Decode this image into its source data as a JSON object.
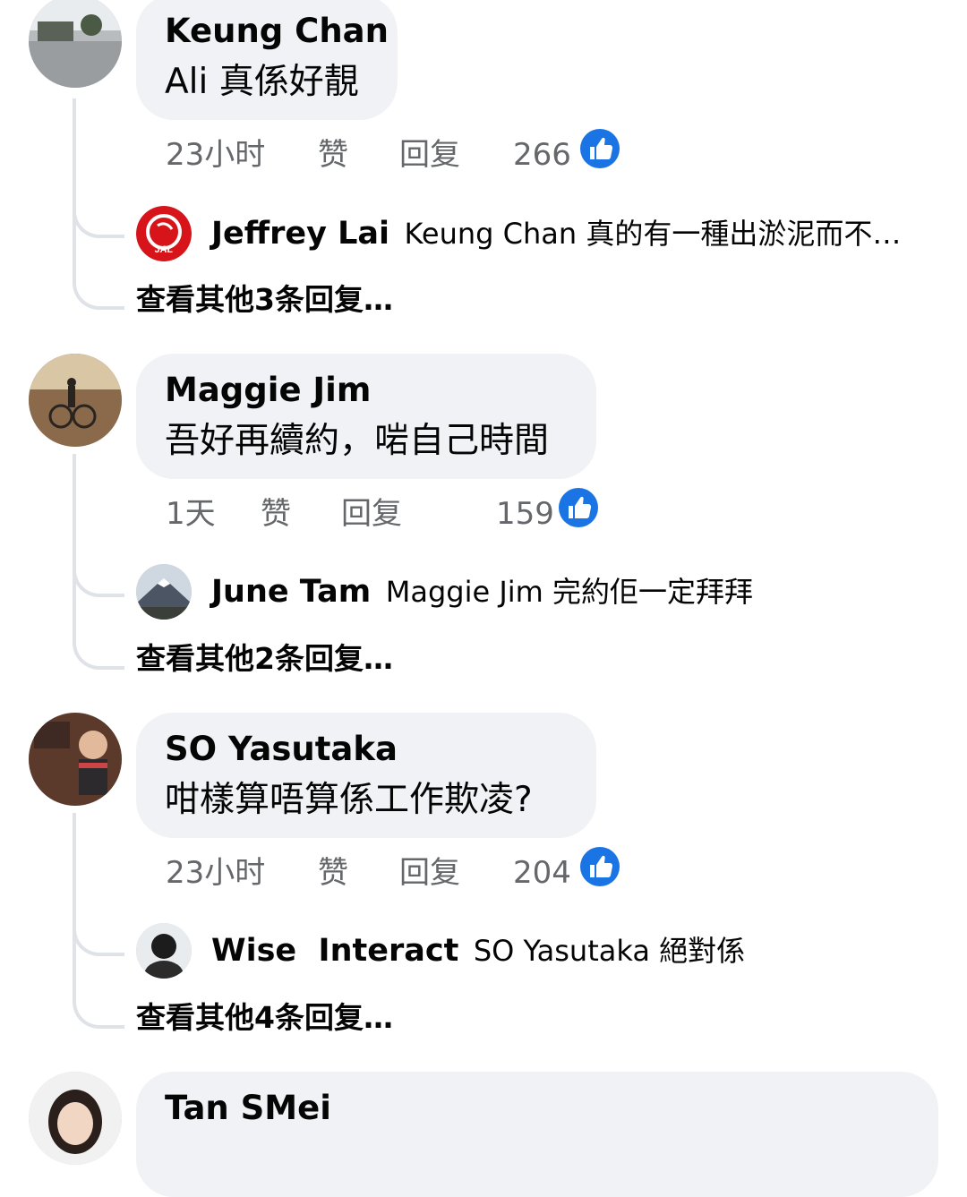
{
  "comments": [
    {
      "author": "Keung Chan",
      "text": "Ali 真係好靚",
      "time": "23小时",
      "like_label": "赞",
      "reply_label": "回复",
      "reactions": "266",
      "reply": {
        "author": "Jeffrey Lai",
        "text": "Keung Chan 真的有一種出淤泥而不…"
      },
      "more_replies": "查看其他3条回复…"
    },
    {
      "author": "Maggie Jim",
      "text": "吾好再續約，啱自己時間",
      "time": "1天",
      "like_label": "赞",
      "reply_label": "回复",
      "reactions": "159",
      "reply": {
        "author": "June Tam",
        "text": "Maggie Jim 完約佢一定拜拜"
      },
      "more_replies": "查看其他2条回复…"
    },
    {
      "author": "SO Yasutaka",
      "text": "咁樣算唔算係工作欺凌?",
      "time": "23小时",
      "like_label": "赞",
      "reply_label": "回复",
      "reactions": "204",
      "reply": {
        "author": "Wise  Interact",
        "text": "SO Yasutaka 絕對係"
      },
      "more_replies": "查看其他4条回复…"
    },
    {
      "author": "Tan SMei"
    }
  ],
  "colors": {
    "bubble": "#f0f2f5",
    "meta_text": "#65676b",
    "like_blue": "#1b74e4",
    "thread_line": "#dfe2e6"
  }
}
